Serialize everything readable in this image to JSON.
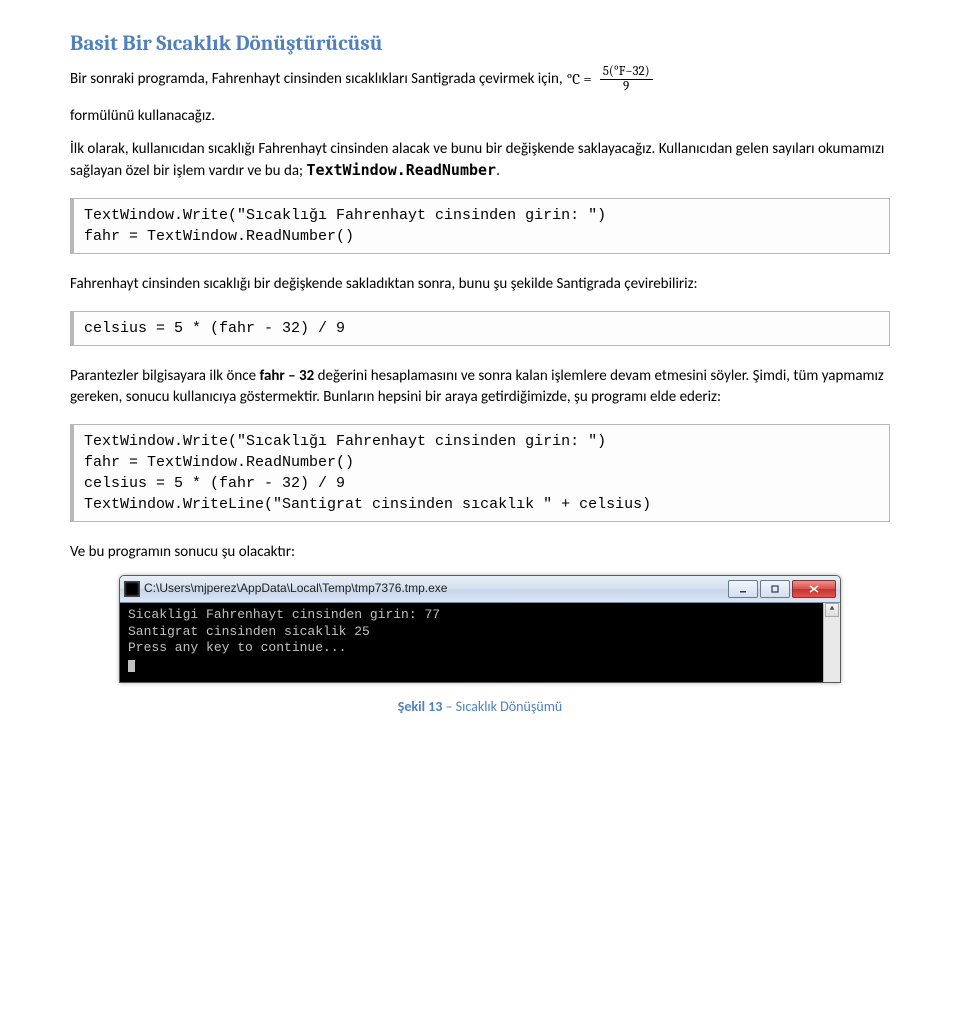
{
  "heading": "Basit Bir Sıcaklık Dönüştürücüsü",
  "p1_pre": "Bir sonraki programda, Fahrenhayt cinsinden sıcaklıkları Santigrada çevirmek için, ",
  "formula": {
    "c_eq": "°C =",
    "num": "5(°F−32)",
    "den": "9"
  },
  "p1_post": "formülünü kullanacağız.",
  "p2a": "İlk olarak, kullanıcıdan sıcaklığı Fahrenhayt cinsinden alacak ve bunu bir değişkende saklayacağız. ",
  "p2b": "Kullanıcıdan gelen sayıları okumamızı sağlayan özel bir işlem vardır ve bu da; ",
  "p2_code": "TextWindow.ReadNumber",
  "p2c": ".",
  "code1": "TextWindow.Write(\"Sıcaklığı Fahrenhayt cinsinden girin: \")\nfahr = TextWindow.ReadNumber()",
  "p3": "Fahrenhayt cinsinden sıcaklığı bir değişkende sakladıktan sonra, bunu şu şekilde Santigrada çevirebiliriz:",
  "code2": "celsius = 5 * (fahr - 32) / 9",
  "p4a": "Parantezler bilgisayara ilk önce ",
  "p4_bold": "fahr – 32",
  "p4b": " değerini hesaplamasını ve sonra kalan işlemlere devam etmesini söyler. Şimdi, tüm yapmamız gereken, sonucu kullanıcıya göstermektir. Bunların hepsini bir araya getirdiğimizde, şu programı elde ederiz:",
  "code3": "TextWindow.Write(\"Sıcaklığı Fahrenhayt cinsinden girin: \")\nfahr = TextWindow.ReadNumber()\ncelsius = 5 * (fahr - 32) / 9\nTextWindow.WriteLine(\"Santigrat cinsinden sıcaklık \" + celsius)",
  "p5": "Ve bu programın sonucu şu olacaktır:",
  "console": {
    "title_path": "C:\\Users\\mjperez\\AppData\\Local\\Temp\\tmp7376.tmp.exe",
    "line1": "Sicakligi Fahrenhayt cinsinden girin: 77",
    "line2": "Santigrat cinsinden sicaklik 25",
    "line3": "Press any key to continue..."
  },
  "caption_label": "Şekil 13",
  "caption_rest": " – Sıcaklık Dönüşümü"
}
